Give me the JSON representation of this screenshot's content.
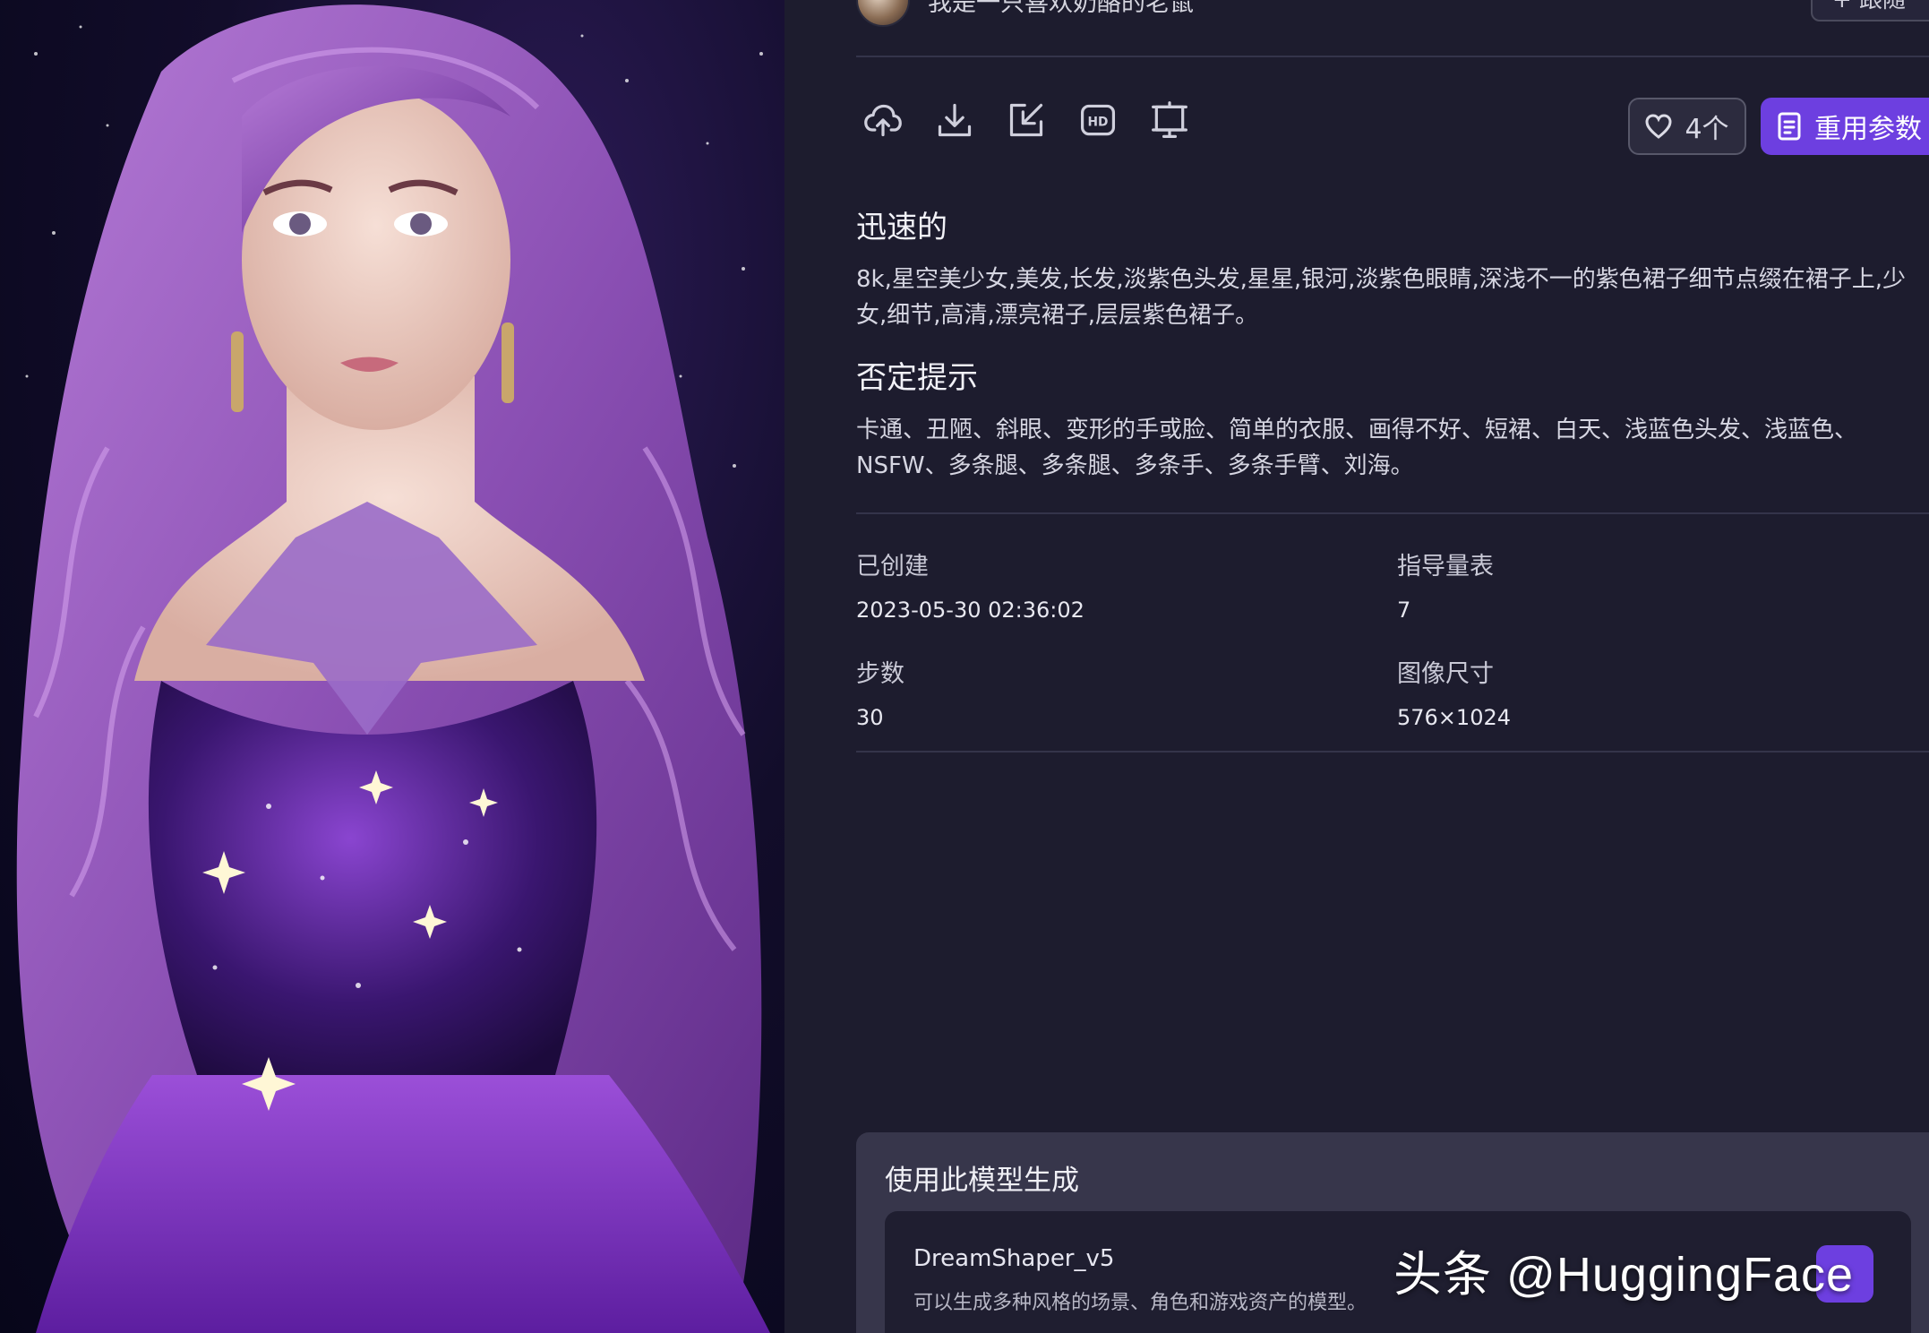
{
  "author": {
    "name": "我是一只喜欢奶酪的老鼠",
    "follow_label": "+ 跟随"
  },
  "toolbar": {
    "icons": [
      "cloud-upload-icon",
      "download-icon",
      "export-icon",
      "hd-icon",
      "slideshow-icon"
    ],
    "like_count": "4个",
    "reuse_label": "重用参数"
  },
  "prompt": {
    "title": "迅速的",
    "text": "8k,星空美少女,美发,长发,淡紫色头发,星星,银河,淡紫色眼睛,深浅不一的紫色裙子细节点缀在裙子上,少女,细节,高清,漂亮裙子,层层紫色裙子。"
  },
  "negative": {
    "title": "否定提示",
    "text": "卡通、丑陋、斜眼、变形的手或脸、简单的衣服、画得不好、短裙、白天、浅蓝色头发、浅蓝色、NSFW、多条腿、多条腿、多条手、多条手臂、刘海。"
  },
  "meta": {
    "created_label": "已创建",
    "created_value": "2023-05-30 02:36:02",
    "guidance_label": "指导量表",
    "guidance_value": "7",
    "steps_label": "步数",
    "steps_value": "30",
    "size_label": "图像尺寸",
    "size_value": "576×1024"
  },
  "generate": {
    "title": "使用此模型生成",
    "model_name": "DreamShaper_v5",
    "model_desc": "可以生成多种风格的场景、角色和游戏资产的模型。"
  },
  "watermark": "头条 @HuggingFace",
  "colors": {
    "background": "#1d1c2e",
    "accent": "#6d3fe0",
    "card": "#37364b"
  }
}
